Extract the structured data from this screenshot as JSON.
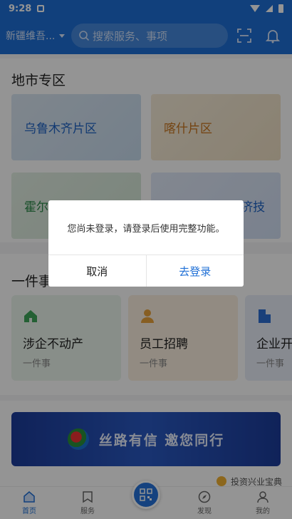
{
  "status": {
    "time": "9:28"
  },
  "header": {
    "region": "新疆维吾...",
    "search_placeholder": "搜索服务、事项"
  },
  "regions": {
    "title": "地市专区",
    "items": [
      {
        "label": "乌鲁木齐片区"
      },
      {
        "label": "喀什片区"
      },
      {
        "label": "霍尔"
      },
      {
        "label": "奎屯-独山子经济技"
      }
    ]
  },
  "oneThing": {
    "title": "一件事",
    "cards": [
      {
        "title": "涉企不动产",
        "sub": "一件事"
      },
      {
        "title": "员工招聘",
        "sub": "一件事"
      },
      {
        "title": "企业开",
        "sub": "一件事"
      }
    ]
  },
  "banner": {
    "text": "丝路有信  邀您同行"
  },
  "invest": {
    "label": "投资兴业宝典"
  },
  "nav": {
    "home": "首页",
    "service": "服务",
    "discover": "发现",
    "mine": "我的"
  },
  "dialog": {
    "message": "您尚未登录，请登录后使用完整功能。",
    "cancel": "取消",
    "login": "去登录"
  },
  "colors": {
    "primary": "#1e6fd6"
  }
}
